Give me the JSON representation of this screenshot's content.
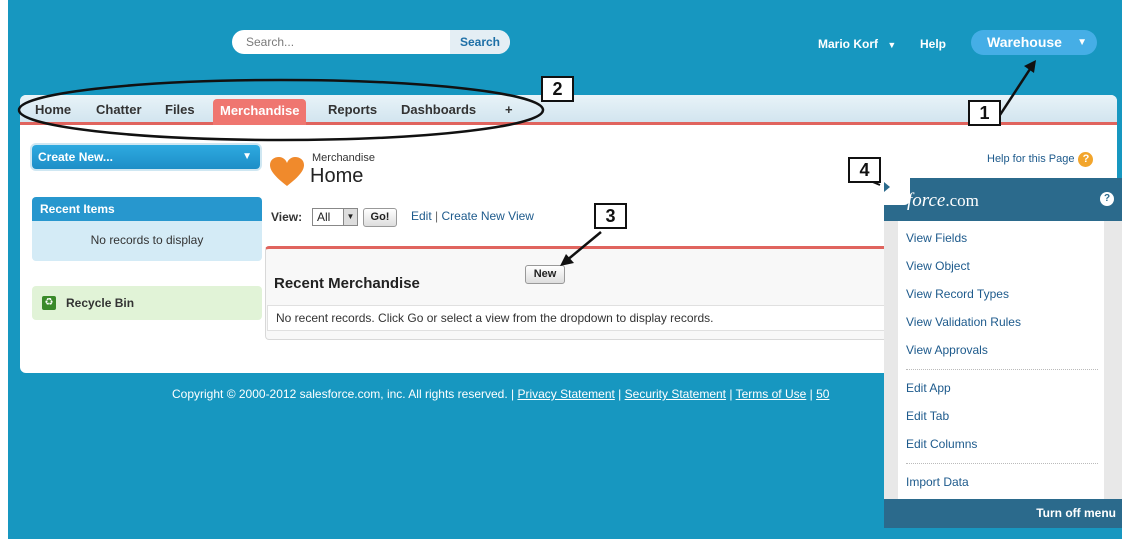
{
  "header": {
    "search_placeholder": "Search...",
    "search_button": "Search",
    "user_name": "Mario Korf",
    "help": "Help",
    "app_name": "Warehouse"
  },
  "tabs": [
    {
      "label": "Home",
      "active": false
    },
    {
      "label": "Chatter",
      "active": false
    },
    {
      "label": "Files",
      "active": false
    },
    {
      "label": "Merchandise",
      "active": true
    },
    {
      "label": "Reports",
      "active": false
    },
    {
      "label": "Dashboards",
      "active": false
    },
    {
      "label": "+",
      "active": false
    }
  ],
  "sidebar": {
    "create_new": "Create New...",
    "recent_items_title": "Recent Items",
    "recent_items_empty": "No records to display",
    "recycle_bin": "Recycle Bin"
  },
  "page": {
    "object_label": "Merchandise",
    "title": "Home",
    "view_label": "View:",
    "view_selected": "All",
    "go_button": "Go!",
    "edit_link": "Edit",
    "create_view_link": "Create New View",
    "help_for_page": "Help for this Page",
    "recent_title": "Recent Merchandise",
    "new_button": "New",
    "no_recent": "No recent records. Click Go or select a view from the dropdown to display records."
  },
  "footer": {
    "copyright": "Copyright © 2000-2012 salesforce.com, inc. All rights reserved. |",
    "privacy": "Privacy Statement",
    "security": "Security Statement",
    "terms": "Terms of Use",
    "more": "50"
  },
  "force_menu": {
    "logo": "force",
    "logo_suffix": ".com",
    "items_group1": [
      "View Fields",
      "View Object",
      "View Record Types",
      "View Validation Rules",
      "View Approvals"
    ],
    "items_group2": [
      "Edit App",
      "Edit Tab",
      "Edit Columns"
    ],
    "items_group3": [
      "Import Data"
    ],
    "turn_off": "Turn off menu"
  },
  "callouts": [
    "1",
    "2",
    "3",
    "4"
  ],
  "colors": {
    "header_blue": "#1797c0",
    "active_tab": "#ef7670",
    "force_blue": "#2b6a8c"
  }
}
